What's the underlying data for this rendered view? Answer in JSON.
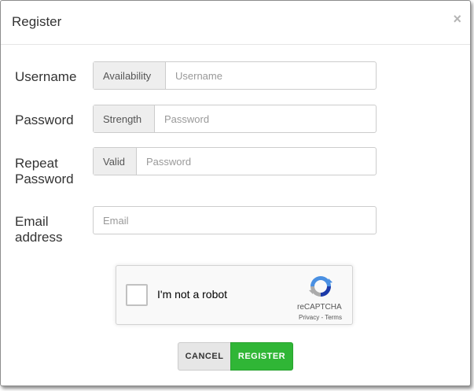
{
  "header": {
    "title": "Register",
    "close_label": "×"
  },
  "form": {
    "username": {
      "label": "Username",
      "addon": "Availability",
      "placeholder": "Username"
    },
    "password": {
      "label": "Password",
      "addon": "Strength",
      "placeholder": "Password"
    },
    "repeat_password": {
      "label_line1": "Repeat",
      "label_line2": "Password",
      "addon": "Valid",
      "placeholder": "Password"
    },
    "email": {
      "label_line1": "Email",
      "label_line2": "address",
      "placeholder": "Email"
    }
  },
  "captcha": {
    "text": "I'm not a robot",
    "brand": "reCAPTCHA",
    "links": "Privacy - Terms"
  },
  "buttons": {
    "cancel": "CANCEL",
    "register": "REGISTER"
  }
}
